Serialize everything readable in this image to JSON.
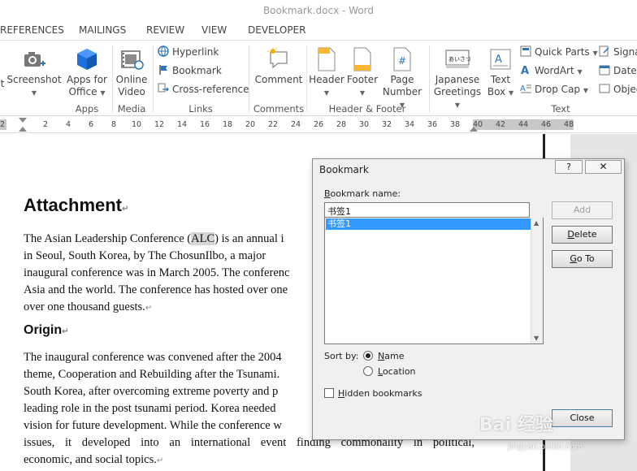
{
  "window": {
    "title": "Bookmark.docx - Word"
  },
  "tabs": [
    "REFERENCES",
    "MAILINGS",
    "REVIEW",
    "VIEW",
    "DEVELOPER"
  ],
  "ribbon": {
    "screenshot": "Screenshot",
    "apps_for_office_1": "Apps for",
    "apps_for_office_2": "Office",
    "online_video_1": "Online",
    "online_video_2": "Video",
    "hyperlink": "Hyperlink",
    "bookmark": "Bookmark",
    "cross_reference": "Cross-reference",
    "comment": "Comment",
    "header": "Header",
    "footer": "Footer",
    "page_number_1": "Page",
    "page_number_2": "Number",
    "japanese_greetings_1": "Japanese",
    "japanese_greetings_2": "Greetings",
    "japanese_icon_text": "あいさつ",
    "text_box_1": "Text",
    "text_box_2": "Box",
    "quick_parts": "Quick Parts",
    "wordart": "WordArt",
    "drop_cap": "Drop Cap",
    "signature": "Signa",
    "date": "Date",
    "object": "Objec",
    "groups": {
      "apps": "Apps",
      "media": "Media",
      "links": "Links",
      "comments": "Comments",
      "header_footer": "Header & Footer",
      "text": "Text"
    }
  },
  "ruler": {
    "ticks": [
      {
        "n": "2",
        "v": 2
      },
      {
        "n": "2",
        "v": -2
      },
      {
        "n": "4",
        "v": 4
      },
      {
        "n": "6",
        "v": 6
      },
      {
        "n": "8",
        "v": 8
      },
      {
        "n": "10",
        "v": 10
      },
      {
        "n": "12",
        "v": 12
      },
      {
        "n": "14",
        "v": 14
      },
      {
        "n": "16",
        "v": 16
      },
      {
        "n": "18",
        "v": 18
      },
      {
        "n": "20",
        "v": 20
      },
      {
        "n": "22",
        "v": 22
      },
      {
        "n": "24",
        "v": 24
      },
      {
        "n": "26",
        "v": 26
      },
      {
        "n": "28",
        "v": 28
      },
      {
        "n": "30",
        "v": 30
      },
      {
        "n": "32",
        "v": 32
      },
      {
        "n": "34",
        "v": 34
      },
      {
        "n": "36",
        "v": 36
      },
      {
        "n": "38",
        "v": 38
      },
      {
        "n": "40",
        "v": 40
      },
      {
        "n": "42",
        "v": 42
      },
      {
        "n": "44",
        "v": 44
      },
      {
        "n": "46",
        "v": 46
      },
      {
        "n": "48",
        "v": 48
      }
    ]
  },
  "document": {
    "heading": "Attachment",
    "p1_line1_a": "The Asian Leadership Conference (",
    "p1_line1_b": "ALC",
    "p1_line1_c": ") is an annual i",
    "p1_line2": "in Seoul, South Korea, by The ChosunIlbo, a major",
    "p1_line3": "inaugural conference was in March 2005. The conferenc",
    "p1_line4": "Asia and the world. The conference has hosted over one",
    "p1_line5": "over one thousand guests.",
    "heading2": "Origin",
    "p2_line1": "The inaugural conference was convened after the 2004",
    "p2_line2": "theme, Cooperation and Rebuilding after the Tsunami.",
    "p2_line3": "South Korea, after overcoming extreme poverty and p",
    "p2_line4": "leading role in the post tsunami period. Korea needed",
    "p2_line5": "vision for future development. While the conference w",
    "p2_line6": "issues, it developed into an international event finding commonality in political,",
    "p2_line7": "economic, and social topics.",
    "para_mark": "↵"
  },
  "dialog": {
    "title": "Bookmark",
    "help": "?",
    "close_x": "✕",
    "name_label": "Bookmark name:",
    "name_value": "书签1",
    "list_items": [
      "书签1"
    ],
    "add": "Add",
    "delete": "Delete",
    "goto": "Go To",
    "sort_by": "Sort by:",
    "sort_name": "Name",
    "sort_location": "Location",
    "hidden": "Hidden bookmarks",
    "close": "Close"
  },
  "watermark": {
    "main": "Bai 经验",
    "sub": "jingyan.baidu.com"
  }
}
